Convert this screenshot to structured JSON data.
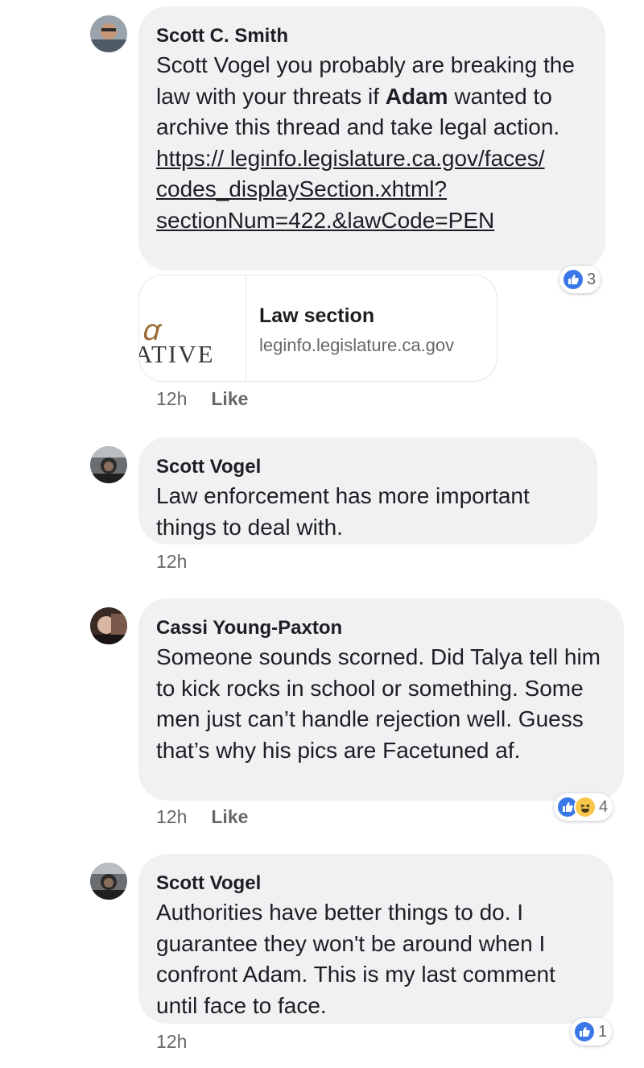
{
  "comments": [
    {
      "author": "Scott C. Smith",
      "text_before": "Scott Vogel you probably are breaking the law with your threats if ",
      "text_bold": "Adam",
      "text_after": " wanted to archive this thread and take legal action. ",
      "link": "https://leginfo.legislature.ca.gov/faces/codes_displaySection.xhtml?sectionNum=422.&lawCode=PEN",
      "link_lines": [
        "https://",
        "leginfo.legislature.ca.gov/faces/",
        "codes_displaySection.xhtml?",
        "sectionNum=422.&lawCode=PEN"
      ],
      "reaction_count": "3",
      "preview": {
        "title": "Law section",
        "domain": "leginfo.legislature.ca.gov",
        "image_text": "ATIVE"
      },
      "time": "12h",
      "like_label": "Like"
    },
    {
      "author": "Scott Vogel",
      "text": "Law enforcement has more important things to deal with.",
      "time": "12h"
    },
    {
      "author": "Cassi Young-Paxton",
      "text": "Someone sounds scorned. Did Talya tell him to kick rocks in school or something. Some men just can’t handle rejection well. Guess that’s why his pics are Facetuned af.",
      "reaction_count": "4",
      "time": "12h",
      "like_label": "Like"
    },
    {
      "author": "Scott Vogel",
      "text": "Authorities have better things to do. I guarantee they won't be around when I confront Adam. This is my last comment until face to face.",
      "reaction_count": "1",
      "time": "12h"
    }
  ],
  "colors": {
    "bubble": "#eff1f3",
    "like_blue": "#3b78e7",
    "meta_gray": "#65676b"
  },
  "icons": [
    "thumbs-up-icon",
    "haha-icon"
  ]
}
